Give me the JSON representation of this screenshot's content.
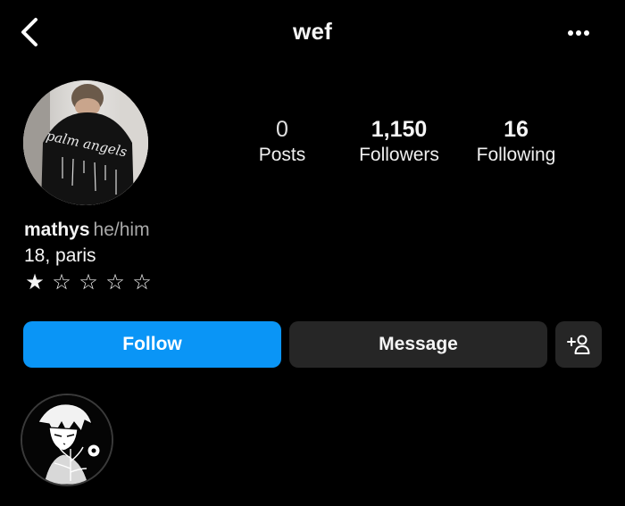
{
  "header": {
    "title": "wef",
    "back_icon": "chevron-left-icon",
    "more_icon": "more-horizontal-icon"
  },
  "profile": {
    "stats": [
      {
        "value": "0",
        "label": "Posts"
      },
      {
        "value": "1,150",
        "label": "Followers"
      },
      {
        "value": "16",
        "label": "Following"
      }
    ],
    "name": "mathys",
    "pronouns": "he/him",
    "bio_line": "18, paris",
    "stars": [
      "★",
      "☆",
      "☆",
      "☆",
      "☆"
    ],
    "rating": 1,
    "rating_max": 5
  },
  "actions": {
    "follow_label": "Follow",
    "message_label": "Message",
    "add_user_icon": "add-user-icon"
  },
  "colors": {
    "background": "#000000",
    "follow_button": "#0a95f6",
    "secondary_button": "#262626",
    "muted_text": "#a8a8a8"
  }
}
